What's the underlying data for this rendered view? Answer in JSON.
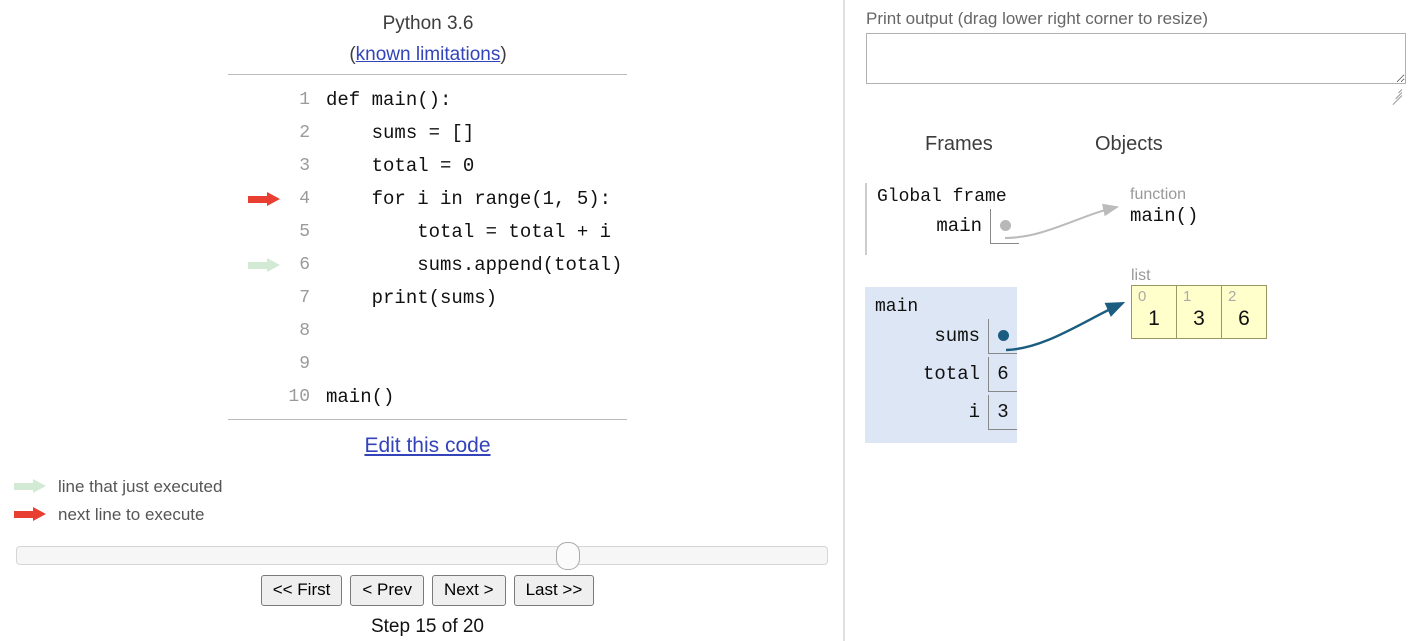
{
  "left": {
    "python_version": "Python 3.6",
    "known_limitations_prefix": "(",
    "known_limitations": "known limitations",
    "known_limitations_suffix": ")",
    "code_lines": [
      {
        "num": "1",
        "text": "def main():",
        "arrow": "none"
      },
      {
        "num": "2",
        "text": "    sums = []",
        "arrow": "none"
      },
      {
        "num": "3",
        "text": "    total = 0",
        "arrow": "none"
      },
      {
        "num": "4",
        "text": "    for i in range(1, 5):",
        "arrow": "red"
      },
      {
        "num": "5",
        "text": "        total = total + i",
        "arrow": "none"
      },
      {
        "num": "6",
        "text": "        sums.append(total)",
        "arrow": "green"
      },
      {
        "num": "7",
        "text": "    print(sums)",
        "arrow": "none"
      },
      {
        "num": "8",
        "text": "",
        "arrow": "none"
      },
      {
        "num": "9",
        "text": "",
        "arrow": "none"
      },
      {
        "num": "10",
        "text": "main()",
        "arrow": "none"
      }
    ],
    "edit_code_link": "Edit this code",
    "legend": [
      {
        "arrow": "green",
        "label": "line that just executed"
      },
      {
        "arrow": "red",
        "label": "next line to execute"
      }
    ],
    "nav_buttons": [
      {
        "label": "<< First"
      },
      {
        "label": "< Prev"
      },
      {
        "label": "Next >"
      },
      {
        "label": "Last >>"
      }
    ],
    "step_label": "Step 15 of 20",
    "slider_position_pct": 68
  },
  "right": {
    "print_output_label": "Print output (drag lower right corner to resize)",
    "print_output_value": "",
    "frames_heading": "Frames",
    "objects_heading": "Objects",
    "global_frame": {
      "title": "Global frame",
      "vars": [
        {
          "name": "main",
          "value": "",
          "is_pointer": true
        }
      ]
    },
    "main_frame": {
      "title": "main",
      "vars": [
        {
          "name": "sums",
          "value": "",
          "is_pointer": true
        },
        {
          "name": "total",
          "value": "6",
          "is_pointer": false
        },
        {
          "name": "i",
          "value": "3",
          "is_pointer": false
        }
      ]
    },
    "function_object": {
      "type_label": "function",
      "name": "main()"
    },
    "list_object": {
      "type_label": "list",
      "cells": [
        {
          "index": "0",
          "value": "1"
        },
        {
          "index": "1",
          "value": "3"
        },
        {
          "index": "2",
          "value": "6"
        }
      ]
    }
  },
  "colors": {
    "next_line_arrow": "#e93f33",
    "executed_line_arrow": "#d2ead3",
    "frame_background": "#dde6f4",
    "list_cell_background": "#ffffcc",
    "pointer_arrow": "#1a5d80",
    "function_arrow": "#bbbbbb",
    "link": "#3344bb"
  }
}
